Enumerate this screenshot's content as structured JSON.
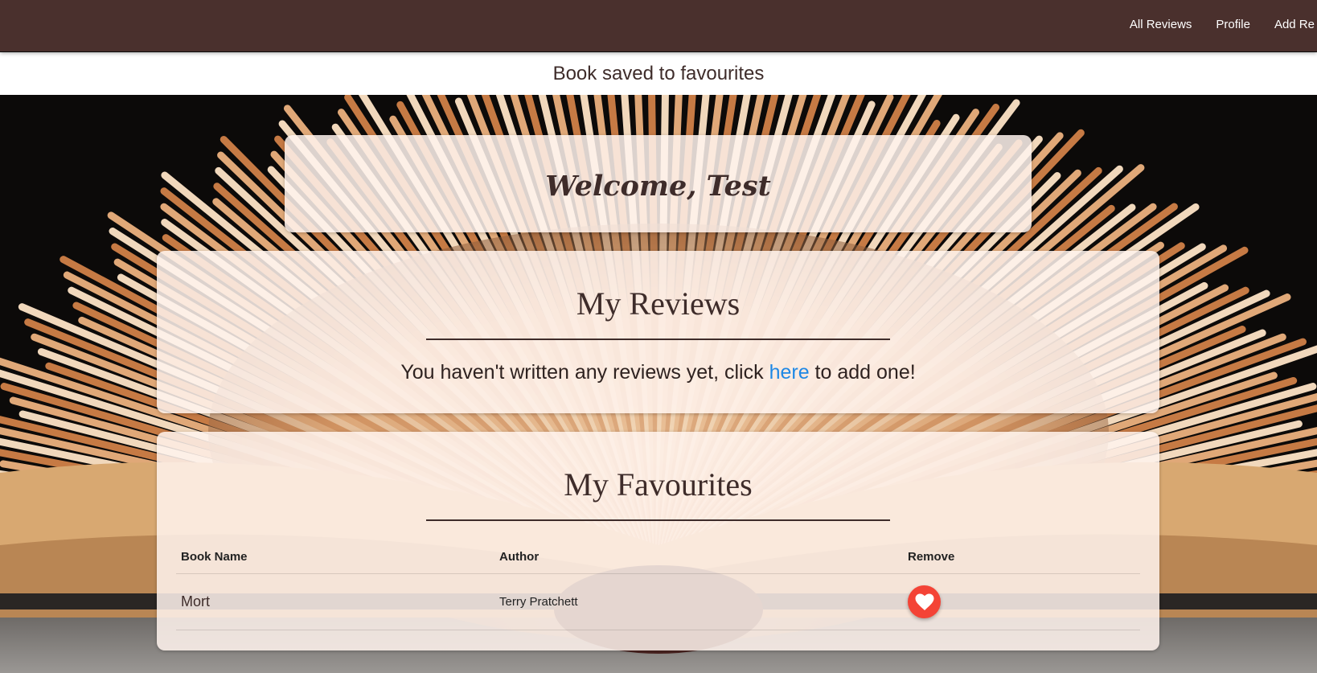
{
  "nav": {
    "links": [
      "All Reviews",
      "Profile",
      "Add Re"
    ]
  },
  "flash": {
    "message": "Book saved to favourites"
  },
  "welcome": {
    "title": "Welcome, Test"
  },
  "reviews": {
    "title": "My Reviews",
    "empty_before": "You haven't written any reviews yet, click ",
    "empty_link": "here",
    "empty_after": " to add one!"
  },
  "favourites": {
    "title": "My Favourites",
    "columns": [
      "Book Name",
      "Author",
      "Remove"
    ],
    "rows": [
      {
        "book": "Mort",
        "author": "Terry Pratchett"
      }
    ]
  },
  "colors": {
    "navbar": "#4a302d",
    "text": "#3e2c2a",
    "link": "#1e88e5",
    "remove_button": "#f44336"
  },
  "icons": {
    "remove": "heart-icon"
  }
}
